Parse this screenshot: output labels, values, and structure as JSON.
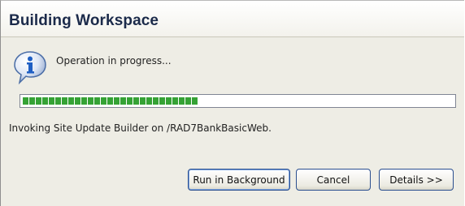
{
  "dialog": {
    "title": "Building Workspace",
    "icon": "info-icon",
    "message": "Operation in progress...",
    "progress_fraction": 0.41,
    "status_text": "Invoking Site Update Builder on /RAD7BankBasicWeb.",
    "buttons": {
      "run_background": "Run in Background",
      "cancel": "Cancel",
      "details": "Details >>"
    }
  },
  "colors": {
    "progress_green": "#35a235",
    "title_text": "#1b2a4a",
    "button_border": "#2b4f8f",
    "dialog_bg": "#eeede5"
  }
}
